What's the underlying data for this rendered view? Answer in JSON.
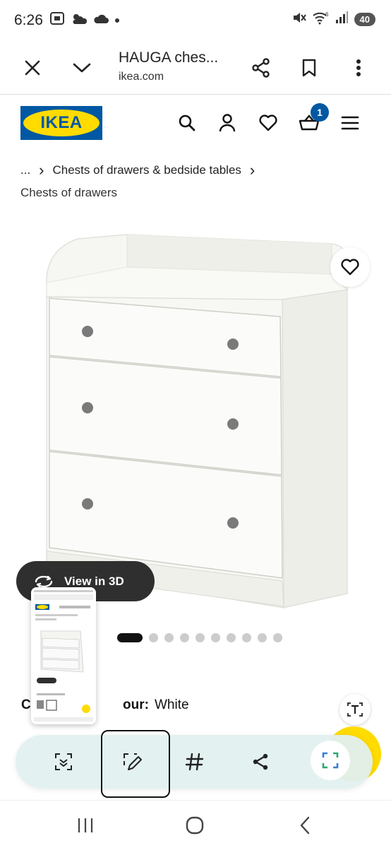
{
  "status_bar": {
    "time": "6:26",
    "battery": "40",
    "network": "6"
  },
  "browser": {
    "page_title": "HAUGA ches...",
    "url": "ikea.com"
  },
  "header": {
    "logo_text": "IKEA",
    "cart_count": "1"
  },
  "breadcrumb": {
    "ellipsis": "...",
    "chevron": "›",
    "parent": "Chests of drawers & bedside tables",
    "current": "Chests of drawers"
  },
  "product": {
    "view3d_label": "View in 3D",
    "carousel_total": 10,
    "carousel_active": 0,
    "colour_prefix": "C",
    "colour_label": "our:",
    "colour_value": "White"
  },
  "colors": {
    "ikea_blue": "#0058a3",
    "ikea_yellow": "#ffdb00",
    "toolbar_bg": "#e2f0f0"
  },
  "capture_toolbar": {
    "items": [
      "scan-text-icon",
      "draw-icon",
      "hashtag-icon",
      "share-icon",
      "expand-icon"
    ]
  }
}
